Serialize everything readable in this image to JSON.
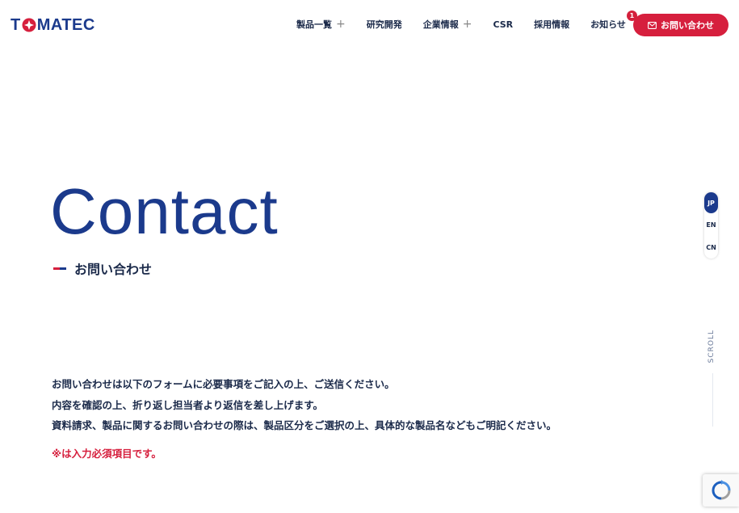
{
  "header": {
    "logo_text": "TOMATEC",
    "nav": [
      {
        "label": "製品一覧",
        "expand": true
      },
      {
        "label": "研究開発",
        "expand": false
      },
      {
        "label": "企業情報",
        "expand": true
      },
      {
        "label": "CSR",
        "expand": false
      },
      {
        "label": "採用情報",
        "expand": false
      },
      {
        "label": "お知らせ",
        "expand": false,
        "badge": "1"
      }
    ],
    "contact_button": "お問い合わせ"
  },
  "hero": {
    "title": "Contact",
    "subtitle": "お問い合わせ"
  },
  "languages": [
    "JP",
    "EN",
    "CN"
  ],
  "active_language": "JP",
  "scroll_label": "SCROLL",
  "intro": {
    "lines": [
      "お問い合わせは以下のフォームに必要事項をご記入の上、ご送信ください。",
      "内容を確認の上、折り返し担当者より返信を差し上げます。",
      "資料請求、製品に関するお問い合わせの際は、製品区分をご選択の上、具体的な製品名などもご明記ください。"
    ],
    "required_note": "※は入力必須項目です。"
  },
  "colors": {
    "brand_blue": "#1b3a8c",
    "accent_red": "#d61f3d"
  },
  "icons": {
    "mail": "mail-icon",
    "expand": "plus-icon",
    "recaptcha": "recaptcha-icon"
  }
}
